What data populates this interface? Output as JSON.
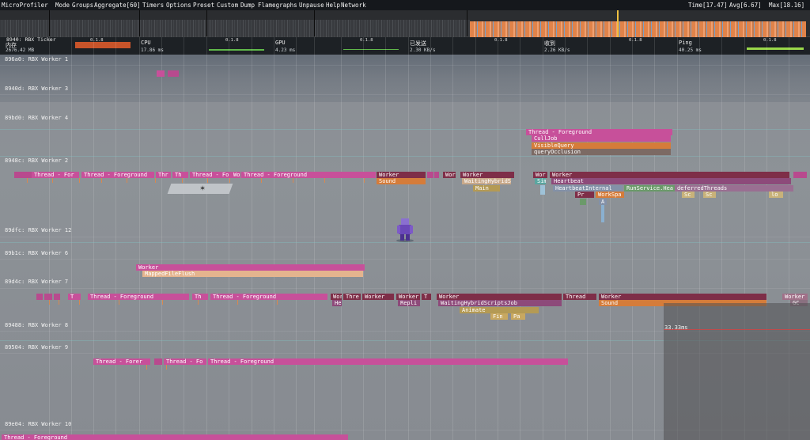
{
  "menu": {
    "title": "MicroProfiler",
    "items": [
      "Mode",
      "Groups",
      "Aggregate[60]",
      "Timers",
      "Options",
      "Preset",
      "Custom",
      "Dump",
      "Flamegraphs",
      "Unpause",
      "Help",
      "Network"
    ],
    "time": "Time[17.47]",
    "avg": "Avg[6.67]",
    "max": "Max[18.16]"
  },
  "stats": {
    "memory": {
      "label": "内存",
      "value": "2676.42 MB"
    },
    "cpu": {
      "label": "CPU",
      "value": "17.86 ms"
    },
    "gpu": {
      "label": "GPU",
      "value": "4.23 ms"
    },
    "sent": {
      "label": "已发送",
      "value": "2.30 KB/s"
    },
    "received": {
      "label": "收到",
      "value": "2.26 KB/s"
    },
    "ping": {
      "label": "Ping",
      "value": "40.25 ms"
    },
    "ticker": "8940: RBX Ticker"
  },
  "ticks": {
    "label": "0.1.8"
  },
  "threads": [
    {
      "label": "896a0: RBX Worker 1"
    },
    {
      "label": "8940d: RBX Worker 3"
    },
    {
      "label": "89bd0: RBX Worker 4"
    },
    {
      "label": "8948c: RBX Worker 2"
    },
    {
      "label": "89dfc: RBX Worker 12"
    },
    {
      "label": "89b1c: RBX Worker 6"
    },
    {
      "label": "89d4c: RBX Worker 7"
    },
    {
      "label": "89488: RBX Worker 8"
    },
    {
      "label": "89504: RBX Worker 9"
    },
    {
      "label": "89e04: RBX Worker 10"
    }
  ],
  "bars": {
    "w4_thread_foreground": "Thread - Foreground",
    "w4_culljob": "CullJob",
    "w4_visiblequery": "VisibleQuery",
    "w4_queryocclusion": "queryOcclusion",
    "w2_thread_for": "Thread - For",
    "w2_thread_foreground": "Thread - Foreground",
    "w2_thr": "Thr",
    "w2_th": "Th",
    "w2_thread_fo": "Thread - Fo",
    "w2_wo": "Wo",
    "w2_thread_foreground2": "Thread - Foreground",
    "w2_worker": "Worker",
    "w2_sound": "Sound",
    "w2_wor": "Wor",
    "w2_worker2": "Worker",
    "w2_waitinghybrids": "WaitingHybridS",
    "w2_main": "Main",
    "w2_wor2": "Wor",
    "w2_sim": "Sim",
    "w2_worker3": "Worker",
    "w2_heartbeat": "Heartbeat",
    "w2_heartbeatinternal": "HeartbeatInternal",
    "w2_runservice": "RunService.Hea",
    "w2_deferredthreads": "deferredThreads",
    "w2_pr": "Pr",
    "w2_workspa": "WorkSpa",
    "w2_a": "A",
    "w2_sc": "Sc",
    "w2_sc2": "Sc",
    "w2_lo": "lo",
    "w6_worker": "Worker",
    "w6_mappedfileflush": "MappedFileFlush",
    "w7_t": "T",
    "w7_thread_foreground": "Thread - Foreground",
    "w7_th": "Th",
    "w7_thread_foreground2": "Thread - Foreground",
    "w7_wor": "Wor",
    "w7_he": "He",
    "w7_thre": "Thre",
    "w7_worker": "Worker",
    "w7_worker2": "Worker",
    "w7_t2": "T",
    "w7_repli": "Repli",
    "w7_worker3": "Worker",
    "w7_waitinghybrid": "WaitingHybridScriptsJob",
    "w7_animate": "Animate",
    "w7_fin": "Fin",
    "w7_pa": "Pa",
    "w7_thread": "Thread",
    "w7_worker4": "Worker",
    "w7_sound": "Sound",
    "w7_worker5": "Worker",
    "w7_gc": "GC",
    "w9_thread_forer": "Thread - Forer",
    "w9_thread_fo": "Thread - Fo",
    "w9_thread_foreground": "Thread - Foreground",
    "w10_thread_foreground": "Thread - Foreground"
  },
  "ms_label": "33.33ms",
  "colors": {
    "menu_bg": "#15181c",
    "bar_pink": "#c7509a",
    "bar_orange": "#d57c3a",
    "frame_orange": "#e0834a"
  }
}
